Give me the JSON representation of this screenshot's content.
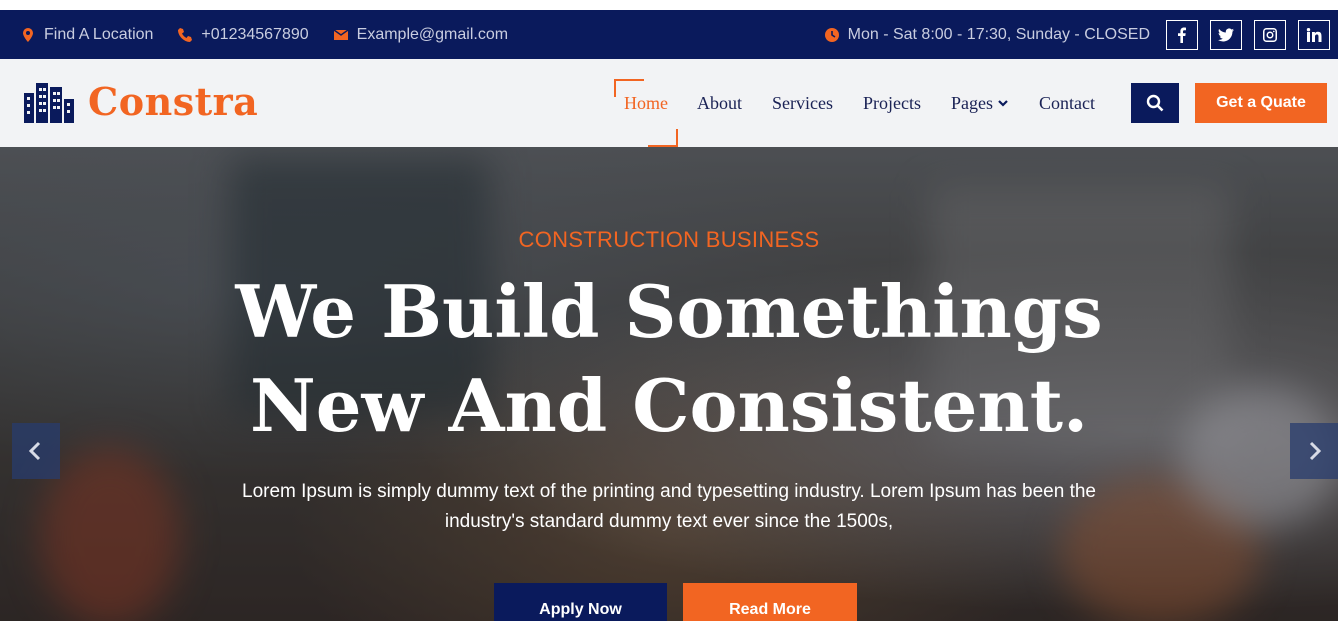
{
  "topbar": {
    "location": "Find A Location",
    "phone": "+01234567890",
    "email": "Example@gmail.com",
    "hours": "Mon - Sat 8:00 - 17:30, Sunday - CLOSED",
    "social": [
      "facebook-icon",
      "twitter-icon",
      "instagram-icon",
      "linkedin-icon"
    ]
  },
  "header": {
    "logo_text": "Constra",
    "nav": {
      "home": "Home",
      "about": "About",
      "services": "Services",
      "projects": "Projects",
      "pages": "Pages",
      "contact": "Contact"
    },
    "quote_button": "Get a Quate"
  },
  "hero": {
    "subtitle": "CONSTRUCTION BUSINESS",
    "title_line1": "We Build Somethings",
    "title_line2": "New And Consistent.",
    "description": "Lorem Ipsum is simply dummy text of the printing and typesetting industry. Lorem Ipsum has been the industry's standard dummy text ever since the 1500s,",
    "apply_button": "Apply Now",
    "read_more_button": "Read More"
  },
  "colors": {
    "brand_navy": "#0a1a5c",
    "accent_orange": "#f26522"
  }
}
